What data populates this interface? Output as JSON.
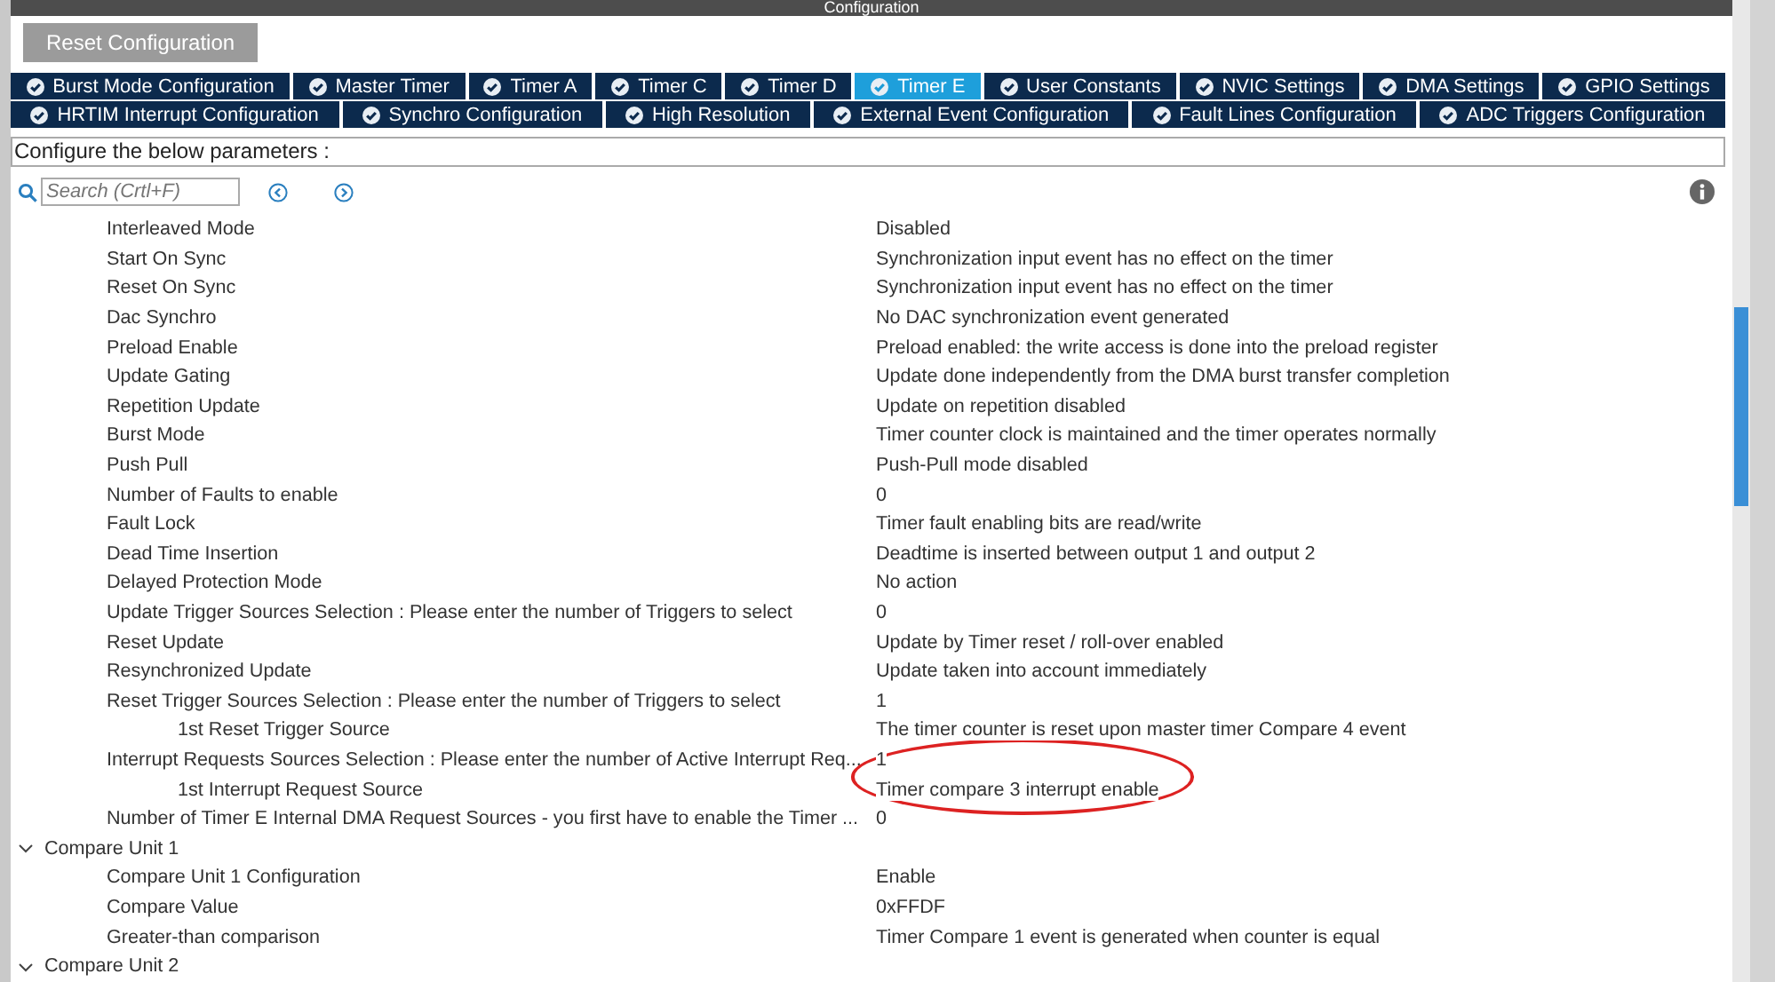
{
  "window": {
    "title": "Configuration"
  },
  "reset_button": "Reset Configuration",
  "tab_rows": [
    [
      {
        "label": "Burst Mode Configuration",
        "selected": false
      },
      {
        "label": "Master Timer",
        "selected": false
      },
      {
        "label": "Timer A",
        "selected": false
      },
      {
        "label": "Timer C",
        "selected": false
      },
      {
        "label": "Timer D",
        "selected": false
      },
      {
        "label": "Timer E",
        "selected": true
      },
      {
        "label": "User Constants",
        "selected": false
      },
      {
        "label": "NVIC Settings",
        "selected": false
      },
      {
        "label": "DMA Settings",
        "selected": false
      },
      {
        "label": "GPIO Settings",
        "selected": false
      }
    ],
    [
      {
        "label": "HRTIM Interrupt Configuration",
        "selected": false
      },
      {
        "label": "Synchro Configuration",
        "selected": false
      },
      {
        "label": "High Resolution",
        "selected": false
      },
      {
        "label": "External Event Configuration",
        "selected": false
      },
      {
        "label": "Fault Lines Configuration",
        "selected": false
      },
      {
        "label": "ADC Triggers Configuration",
        "selected": false
      }
    ]
  ],
  "instructions": "Configure the below parameters :",
  "search": {
    "placeholder": "Search (Crtl+F)"
  },
  "parameters": [
    {
      "name": "Interleaved Mode",
      "value": "Disabled"
    },
    {
      "name": "Start On Sync",
      "value": "Synchronization input event has no effect on the timer"
    },
    {
      "name": "Reset On Sync",
      "value": "Synchronization input event has no effect on the timer"
    },
    {
      "name": "Dac Synchro",
      "value": "No DAC synchronization event generated"
    },
    {
      "name": "Preload Enable",
      "value": "Preload enabled: the write access is done into the preload register"
    },
    {
      "name": "Update Gating",
      "value": "Update done independently from the DMA burst transfer completion"
    },
    {
      "name": "Repetition Update",
      "value": "Update on repetition disabled"
    },
    {
      "name": "Burst Mode",
      "value": "Timer counter clock is maintained and the timer operates normally"
    },
    {
      "name": "Push Pull",
      "value": "Push-Pull mode disabled"
    },
    {
      "name": "Number of Faults to enable",
      "value": "0"
    },
    {
      "name": "Fault Lock",
      "value": "Timer fault enabling bits are read/write"
    },
    {
      "name": "Dead Time Insertion",
      "value": "Deadtime is inserted between output 1 and output 2"
    },
    {
      "name": "Delayed Protection Mode",
      "value": "No action"
    },
    {
      "name": "Update Trigger Sources Selection : Please enter the number of Triggers to select",
      "value": "0"
    },
    {
      "name": "Reset Update",
      "value": "Update by Timer reset / roll-over enabled"
    },
    {
      "name": "Resynchronized Update",
      "value": "Update taken into account immediately"
    },
    {
      "name": "Reset Trigger Sources Selection : Please enter the number of Triggers to select",
      "value": "1",
      "children": [
        {
          "name": "1st Reset Trigger Source",
          "value": "The timer counter is reset upon master timer Compare 4 event"
        }
      ]
    },
    {
      "name": "Interrupt Requests Sources Selection : Please enter the number of Active Interrupt Req...",
      "value": "1",
      "circled": true,
      "children": [
        {
          "name": "1st Interrupt Request Source",
          "value": "Timer compare 3 interrupt enable",
          "circled": true
        }
      ]
    },
    {
      "name": "Number of Timer E Internal DMA Request Sources  - you first have to enable the Timer ...",
      "value": "0"
    }
  ],
  "groups": [
    {
      "title": "Compare Unit 1",
      "expanded": true,
      "parameters": [
        {
          "name": "Compare Unit 1 Configuration",
          "value": "Enable"
        },
        {
          "name": "Compare Value",
          "value": "0xFFDF"
        },
        {
          "name": "Greater-than comparison",
          "value": "Timer Compare 1 event is generated when counter is equal"
        }
      ]
    },
    {
      "title": "Compare Unit 2",
      "expanded": true
    }
  ]
}
